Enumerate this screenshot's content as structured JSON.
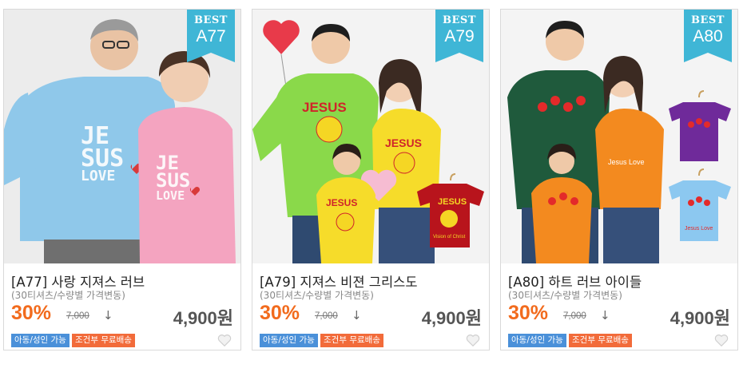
{
  "products": [
    {
      "badge_top": "BEST",
      "badge_code": "A77",
      "title": "[A77] 사랑 지져스 러브",
      "subtitle": "(30티셔츠/수량별 가격변동)",
      "discount": "30%",
      "original_price": "7,000",
      "price_arrow": "↓",
      "price": "4,900원",
      "tags": [
        "아동/성인 가능",
        "조건부 무료배송"
      ],
      "shirt_print": [
        "JE",
        "SUS",
        "LOVE"
      ]
    },
    {
      "badge_top": "BEST",
      "badge_code": "A79",
      "title": "[A79] 지져스 비젼 그리스도",
      "subtitle": "(30티셔츠/수량별 가격변동)",
      "discount": "30%",
      "original_price": "7,000",
      "price_arrow": "↓",
      "price": "4,900원",
      "tags": [
        "아동/성인 가능",
        "조건부 무료배송"
      ],
      "shirt_print": [
        "JESUS",
        "Vision of Christ"
      ]
    },
    {
      "badge_top": "BEST",
      "badge_code": "A80",
      "title": "[A80] 하트 러브 아이들",
      "subtitle": "(30티셔츠/수량별 가격변동)",
      "discount": "30%",
      "original_price": "7,000",
      "price_arrow": "↓",
      "price": "4,900원",
      "tags": [
        "아동/성인 가능",
        "조건부 무료배송"
      ],
      "shirt_print": [
        "Jesus Love"
      ]
    }
  ],
  "icons": {
    "wishlist": "heart-outline-icon",
    "price_arrow": "down-arrow-icon"
  },
  "colors": {
    "badge": "#3fb6d6",
    "discount": "#f26b1d",
    "tag_blue": "#4a90d9",
    "tag_orange": "#f26b3a",
    "price": "#555555"
  }
}
